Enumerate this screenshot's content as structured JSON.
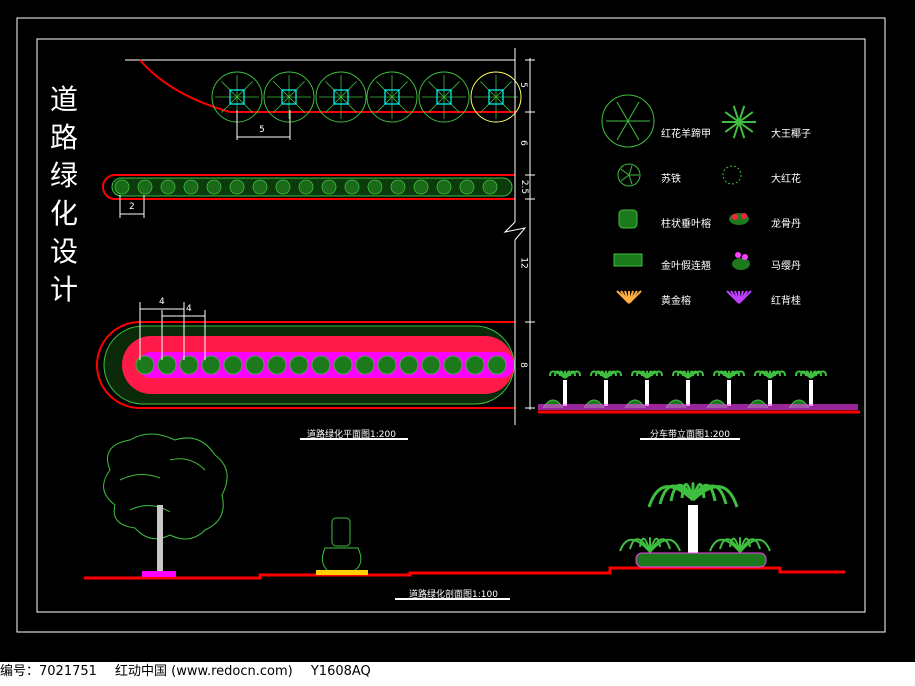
{
  "title": {
    "chars": [
      "道",
      "路",
      "绿",
      "化",
      "设",
      "计"
    ]
  },
  "dimensions": {
    "tree_spacing": "5",
    "shrub_spacing": "2",
    "flower_spacing_a": "4",
    "flower_spacing_b": "4",
    "section_5": "5",
    "section_6": "6",
    "section_25": "2.5",
    "section_12": "12",
    "section_8": "8"
  },
  "legend": [
    {
      "label": "红花羊蹄甲",
      "icon": "tree-round-icon"
    },
    {
      "label": "大王椰子",
      "icon": "palm-icon"
    },
    {
      "label": "苏铁",
      "icon": "cycad-icon"
    },
    {
      "label": "大红花",
      "icon": "hibiscus-icon"
    },
    {
      "label": "柱状垂叶榕",
      "icon": "ficus-icon"
    },
    {
      "label": "龙骨丹",
      "icon": "red-shrub-icon"
    },
    {
      "label": "金叶假连翘",
      "icon": "hedge-icon"
    },
    {
      "label": "马缨丹",
      "icon": "lantana-icon"
    },
    {
      "label": "黄金榕",
      "icon": "golden-ficus-icon"
    },
    {
      "label": "红背桂",
      "icon": "purple-shrub-icon"
    }
  ],
  "captions": {
    "plan": "道路绿化平面图1:200",
    "elevation": "分车带立面图1:200",
    "section": "道路绿化剖面图1:100"
  },
  "footer": {
    "id": "编号：7021751",
    "site": "红动中国 (www.redocn.com)",
    "code": "Y1608AQ"
  },
  "colors": {
    "green": "#3fbf3f",
    "red": "#ff0000",
    "magenta": "#ff00ff",
    "cyan": "#00ffff",
    "white": "#ffffff",
    "yellow": "#ffd000"
  }
}
